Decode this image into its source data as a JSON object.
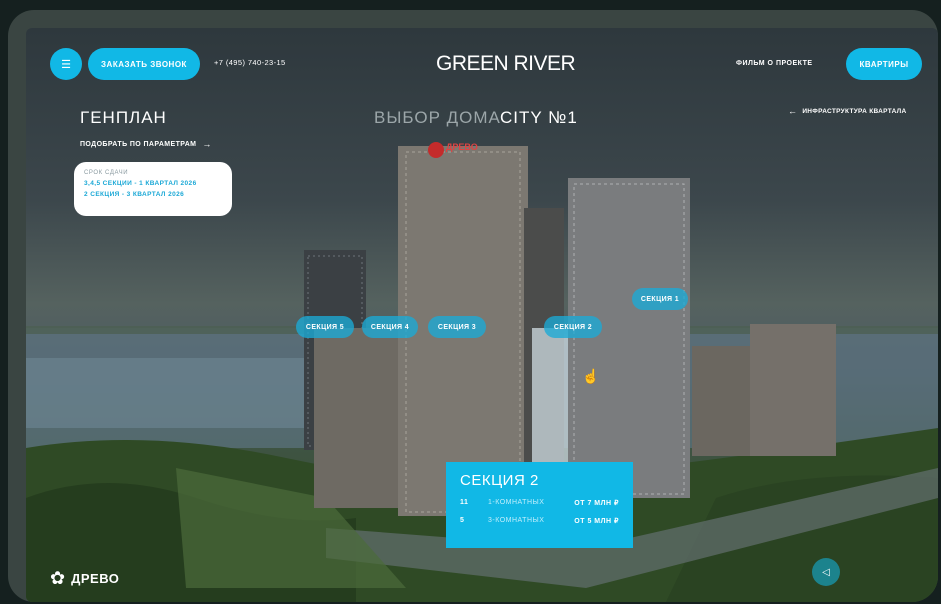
{
  "header": {
    "call_button": "ЗАКАЗАТЬ ЗВОНОК",
    "phone": "+7 (495) 740-23-15",
    "logo": "GREEN RIVER",
    "film_link": "ФИЛЬМ О ПРОЕКТЕ",
    "apartments_button": "КВАРТИРЫ"
  },
  "nav": {
    "title": "ГЕНПЛАН",
    "filter_link": "ПОДОБРАТЬ ПО ПАРАМЕТРАМ",
    "choose_house": "ВЫБОР ДОМА",
    "city": "CITY №1",
    "infrastructure_link": "ИНФРАСТРУКТУРА КВАРТАЛА"
  },
  "delivery": {
    "label": "СРОК СДАЧИ",
    "line1": "3,4,5 СЕКЦИИ - 1 КВАРТАЛ 2026",
    "line2": "2 СЕКЦИЯ - 3 КВАРТАЛ 2026"
  },
  "building_brand": "ДРЕВО",
  "sections": [
    {
      "label": "СЕКЦИЯ 5"
    },
    {
      "label": "СЕКЦИЯ 4"
    },
    {
      "label": "СЕКЦИЯ 3"
    },
    {
      "label": "СЕКЦИЯ 2"
    },
    {
      "label": "СЕКЦИЯ 1"
    }
  ],
  "section_card": {
    "title": "СЕКЦИЯ 2",
    "rows": [
      {
        "count": "11",
        "kind": "1-КОМНАТНЫХ",
        "price": "ОТ 7 МЛН ₽"
      },
      {
        "count": "5",
        "kind": "3-КОМНАТНЫХ",
        "price": "ОТ 5 МЛН ₽"
      }
    ]
  },
  "footer": {
    "brand": "ДРЕВО"
  },
  "colors": {
    "accent": "#11b8e6"
  },
  "icons": {
    "menu": "menu-icon",
    "arrow": "arrow-right-icon",
    "sound": "sound-icon",
    "cursor": "hand-cursor-icon"
  }
}
